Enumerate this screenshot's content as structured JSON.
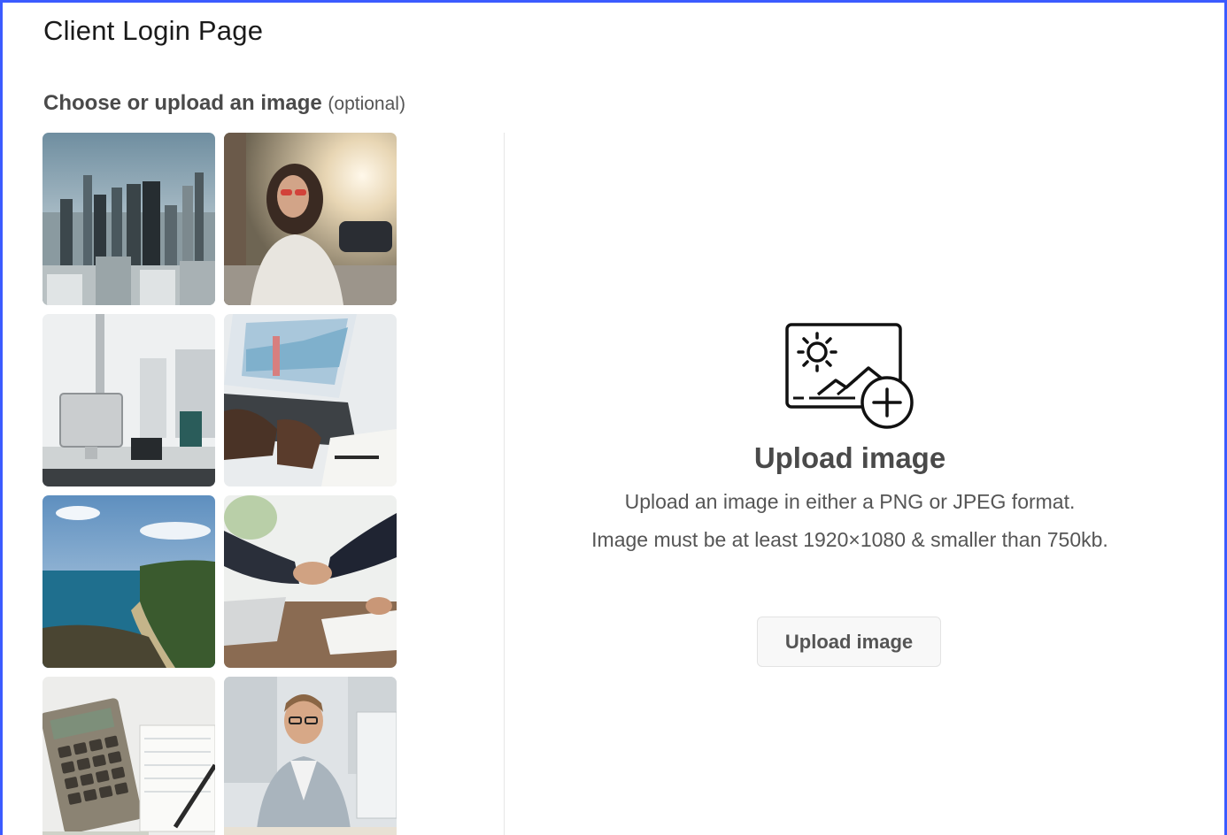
{
  "page": {
    "title": "Client Login Page",
    "accent_border": "#3b5bff"
  },
  "chooser": {
    "label": "Choose or upload an image",
    "optional": "(optional)",
    "images": [
      {
        "subject": "city-skyline"
      },
      {
        "subject": "woman-sunglasses-street"
      },
      {
        "subject": "office-desk-computer"
      },
      {
        "subject": "laptop-chart-typing"
      },
      {
        "subject": "coastline-sea"
      },
      {
        "subject": "business-handshake"
      },
      {
        "subject": "calculator-notebook-pen"
      },
      {
        "subject": "man-on-phone"
      }
    ]
  },
  "upload": {
    "icon": "image-add-icon",
    "title": "Upload image",
    "line1": "Upload an image in either a PNG or JPEG format.",
    "line2": "Image must be at least 1920×1080 & smaller than 750kb.",
    "button_label": "Upload image"
  }
}
